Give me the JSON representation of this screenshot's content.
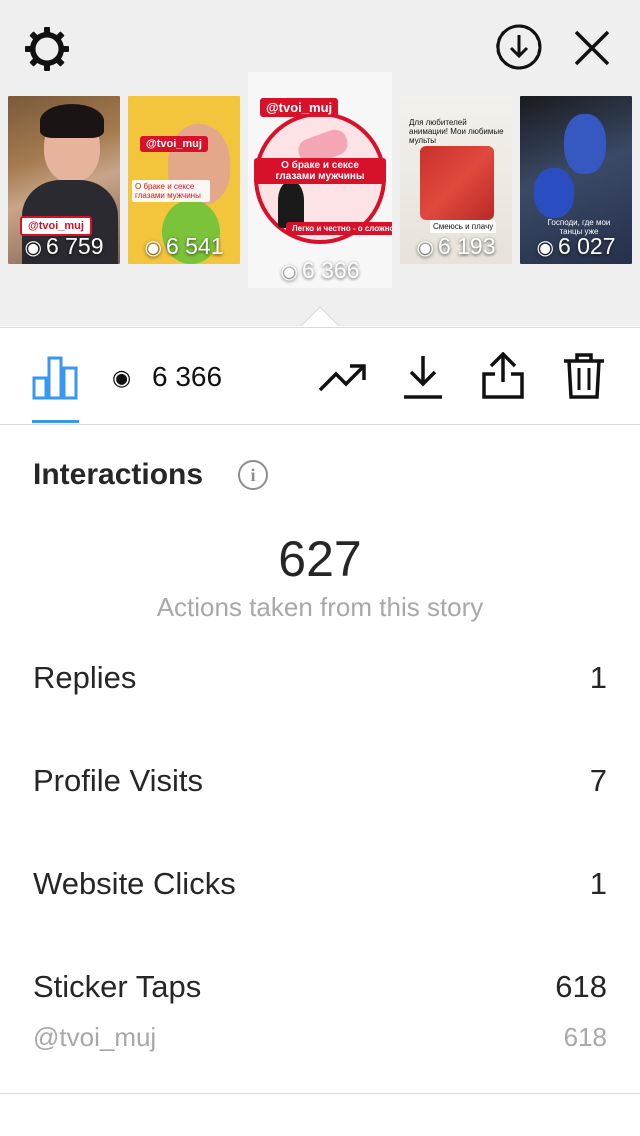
{
  "top_bar": {
    "settings_icon": "settings-gear-icon",
    "download_icon": "download-circle-icon",
    "close_icon": "close-x-icon"
  },
  "story_thumbnails": [
    {
      "views": "6 759",
      "tag": "@tvoi_muj",
      "selected": false
    },
    {
      "views": "6 541",
      "tag": "@tvoi_muj",
      "caption": "О браке и сексе глазами мужчины",
      "selected": false
    },
    {
      "views": "6 366",
      "tag": "@tvoi_muj",
      "caption": "О браке и сексе глазами мужчины",
      "caption2": "Легко и честно - о сложном",
      "selected": true
    },
    {
      "views": "6 193",
      "caption": "Для любителей анимации! Мои любимые мульты",
      "caption2": "Смеюсь и плачу",
      "selected": false
    },
    {
      "views": "6 027",
      "caption": "Господи, где мои танцы уже",
      "selected": false
    }
  ],
  "tabbar": {
    "insights_icon": "bar-chart-icon",
    "views_icon": "eye-icon",
    "views_count": "6 366",
    "promote_icon": "trending-up-icon",
    "save_icon": "download-icon",
    "share_icon": "share-icon",
    "delete_icon": "trash-icon",
    "accent_color": "#3897f0"
  },
  "interactions": {
    "title": "Interactions",
    "total": "627",
    "subtitle": "Actions taken from this story",
    "rows": [
      {
        "label": "Replies",
        "value": "1"
      },
      {
        "label": "Profile Visits",
        "value": "7"
      },
      {
        "label": "Website Clicks",
        "value": "1"
      },
      {
        "label": "Sticker Taps",
        "value": "618"
      }
    ],
    "sticker_sub": {
      "label": "@tvoi_muj",
      "value": "618"
    }
  }
}
